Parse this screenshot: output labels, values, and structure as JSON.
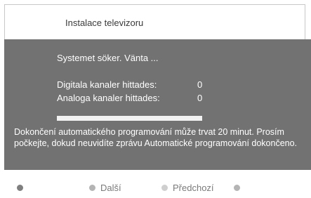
{
  "header": {
    "title": "Instalace televizoru"
  },
  "panel": {
    "status": "Systemet söker. Vänta ...",
    "digital_label": "Digitala kanaler hittades:",
    "digital_value": "0",
    "analog_label": "Analoga kanaler hittades:",
    "analog_value": "0",
    "progress": 1.0,
    "info": "Dokončení automatického programování může trvat 20 minut. Prosím počkejte, dokud neuvidíte zprávu Automatické programování dokončeno."
  },
  "footer": {
    "next_label": "Další",
    "prev_label": "Předchozí",
    "colors": {
      "red_key": "#7f7f7f",
      "green_key": "#b4b4b4",
      "yellow_key": "#cfcfcf",
      "blue_key": "#b4b4b4"
    }
  }
}
